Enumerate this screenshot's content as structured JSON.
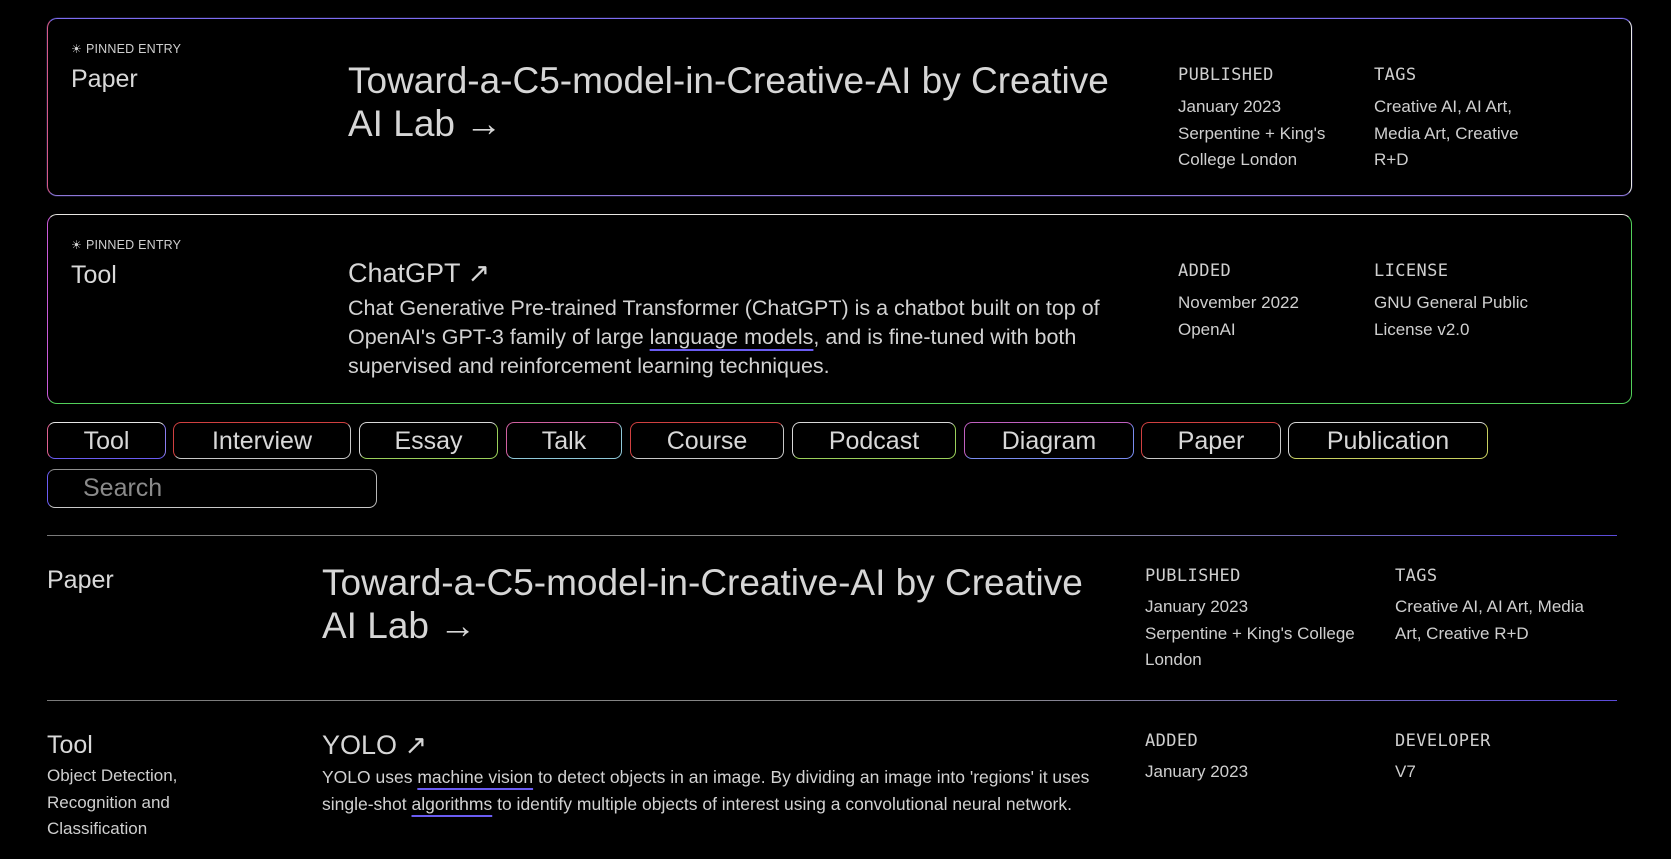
{
  "pinned": [
    {
      "label": "PINNED ENTRY",
      "star": "☀",
      "type": "Paper",
      "title": "Toward-a-C5-model-in-Creative-AI by Creative AI Lab →",
      "meta1_head": "PUBLISHED",
      "meta1_lines": [
        "January 2023",
        "Serpentine + King's",
        "College London"
      ],
      "meta2_head": "TAGS",
      "meta2_lines": [
        "Creative AI, AI Art,",
        "Media Art, Creative",
        "R+D"
      ]
    },
    {
      "label": "PINNED ENTRY",
      "star": "☀",
      "type": "Tool",
      "title": "ChatGPT ↗",
      "desc_pre": "Chat Generative Pre-trained Transformer (ChatGPT) is a chatbot built on top of OpenAI's GPT-3 family of large ",
      "desc_link": "language models",
      "desc_post": ", and is fine-tuned with both supervised and reinforcement learning techniques.",
      "meta1_head": "ADDED",
      "meta1_lines": [
        "November 2022",
        "OpenAI"
      ],
      "meta2_head": "LICENSE",
      "meta2_lines": [
        "GNU General Public",
        "License v2.0"
      ]
    }
  ],
  "filters": [
    "Tool",
    "Interview",
    "Essay",
    "Talk",
    "Course",
    "Podcast",
    "Diagram",
    "Paper",
    "Publication"
  ],
  "search": {
    "placeholder": "Search"
  },
  "entries": [
    {
      "type": "Paper",
      "title": "Toward-a-C5-model-in-Creative-AI by Creative AI Lab →",
      "meta1_head": "PUBLISHED",
      "meta1_lines": [
        "January 2023",
        "Serpentine + King's College",
        "London"
      ],
      "meta2_head": "TAGS",
      "meta2_lines": [
        "Creative AI, AI Art, Media",
        "Art, Creative R+D"
      ]
    },
    {
      "type": "Tool",
      "subtype_lines": [
        "Object Detection,",
        "Recognition and",
        "Classification"
      ],
      "title": "YOLO ↗",
      "desc_pre": "YOLO uses ",
      "desc_link1": "machine vision",
      "desc_mid": " to detect objects in an image. By dividing an image into 'regions' it uses single-shot ",
      "desc_link2": "algorithms",
      "desc_post": " to identify multiple objects of interest using a convolutional neural network.",
      "meta1_head": "ADDED",
      "meta1_lines": [
        "January 2023"
      ],
      "meta2_head": "DEVELOPER",
      "meta2_lines": [
        "V7"
      ]
    }
  ],
  "colors": {
    "background": "#000000",
    "text": "#cfcfcf",
    "link_underline": "#6a5cf2",
    "green_border": "#52d05a"
  }
}
